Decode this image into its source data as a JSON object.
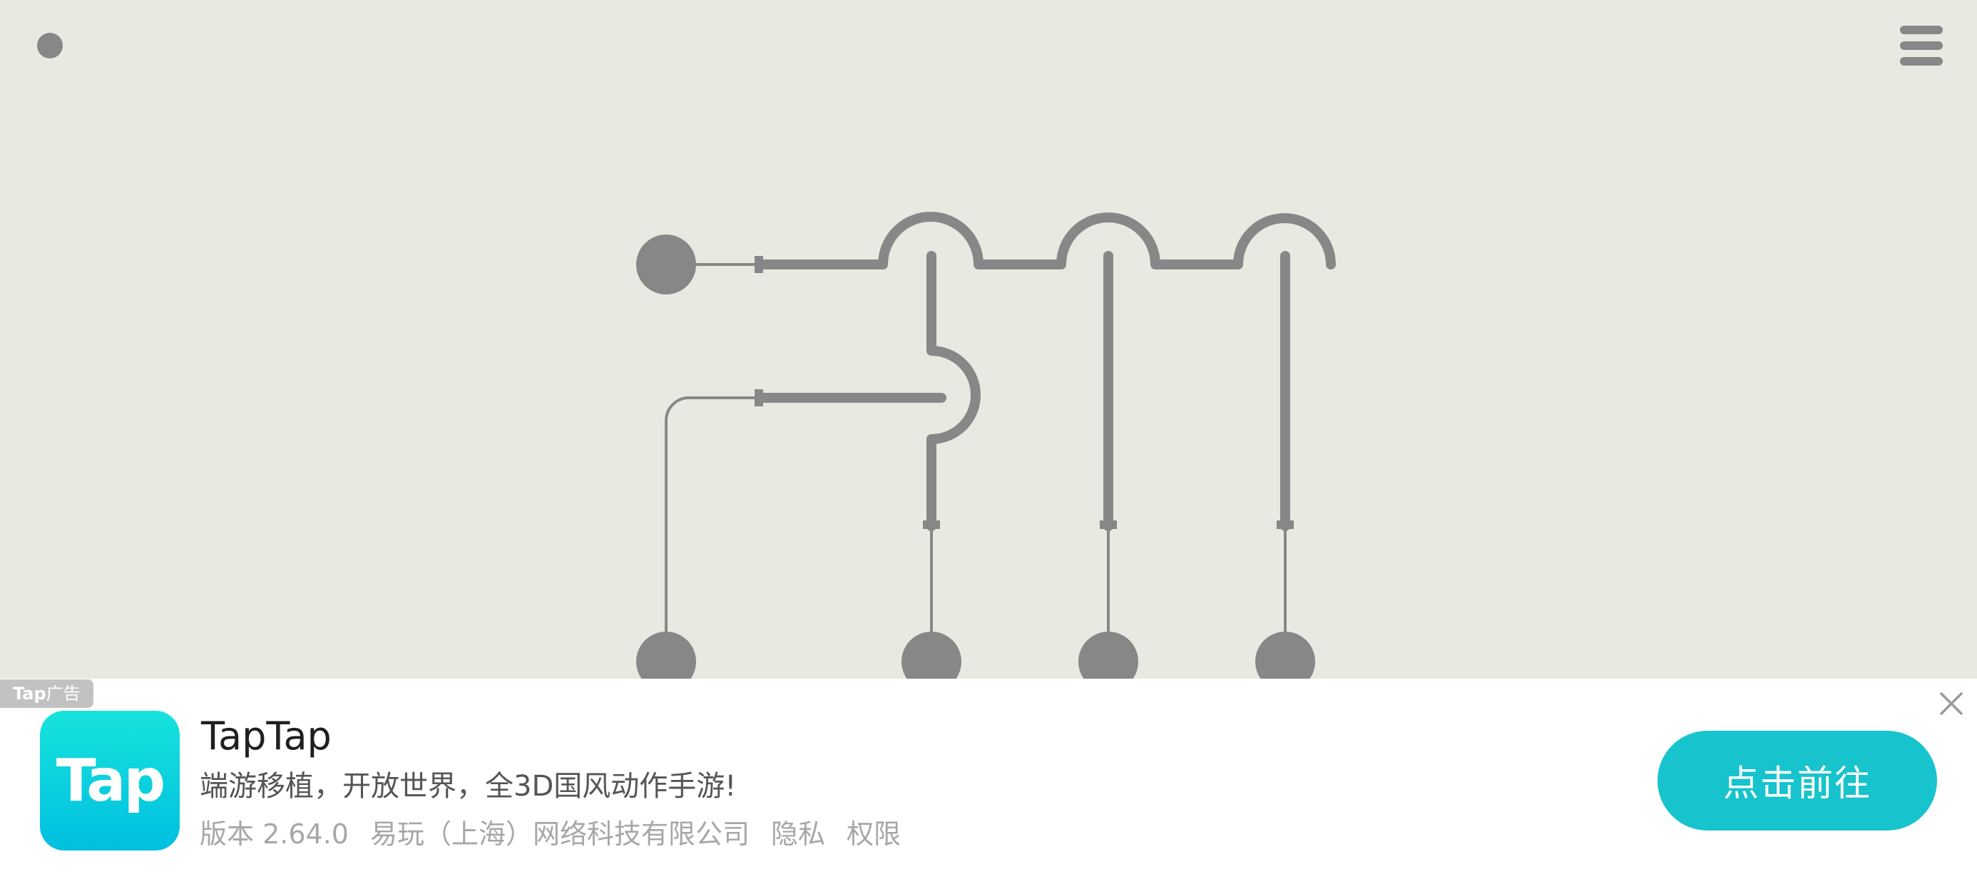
{
  "colors": {
    "game_background": "#e9e8e1",
    "circuit": "#878787",
    "ad_background": "#ffffff",
    "ad_tag": "#c2c2c2",
    "icon_gradient_top": "#17e3dc",
    "icon_gradient_bottom": "#00bfe0",
    "cta": "#17c3cc",
    "title_text": "#1f1f1f",
    "desc_text": "#555555",
    "meta_text": "#a7a7a7",
    "close_icon": "#9a9a9a"
  },
  "game": {
    "status_icon": "dot-icon",
    "menu_icon": "hamburger-menu-icon",
    "node_icon": "circle-node",
    "switch_icon": "arch-switch"
  },
  "ad": {
    "tag": {
      "brand": "Tap",
      "label": "广告"
    },
    "app_icon_text": "Tap",
    "title": "TapTap",
    "description": "端游移植，开放世界，全3D国风动作手游!",
    "meta": {
      "version": "版本 2.64.0",
      "developer": "易玩（上海）网络科技有限公司",
      "privacy": "隐私",
      "permissions": "权限"
    },
    "cta_label": "点击前往",
    "close_icon": "close-x-icon"
  }
}
